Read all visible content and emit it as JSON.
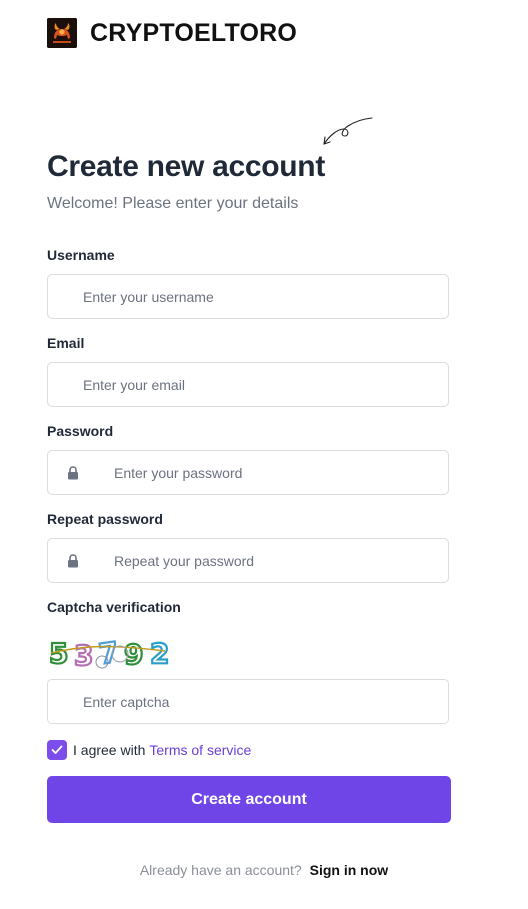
{
  "brand": {
    "name": "CRYPTOELTORO",
    "logo_icon": "bull-logo-icon"
  },
  "header": {
    "title": "Create new account",
    "subtitle": "Welcome! Please enter your details"
  },
  "form": {
    "username": {
      "label": "Username",
      "placeholder": "Enter your username",
      "value": ""
    },
    "email": {
      "label": "Email",
      "placeholder": "Enter your email",
      "value": ""
    },
    "password": {
      "label": "Password",
      "placeholder": "Enter your password",
      "value": "",
      "icon": "lock-icon"
    },
    "repeat_password": {
      "label": "Repeat password",
      "placeholder": "Repeat your password",
      "value": "",
      "icon": "lock-icon"
    },
    "captcha": {
      "label": "Captcha verification",
      "image_text": "53792",
      "placeholder": "Enter captcha",
      "value": ""
    },
    "agree": {
      "checked": true,
      "prefix": "I agree with",
      "link_label": "Terms of service"
    },
    "submit_label": "Create account"
  },
  "footer": {
    "prompt": "Already have an account?",
    "link_label": "Sign in now"
  },
  "colors": {
    "accent": "#7045e7",
    "link": "#6b3fd6",
    "text": "#1f2937",
    "muted": "#6b7280",
    "border": "#d9dce1"
  }
}
